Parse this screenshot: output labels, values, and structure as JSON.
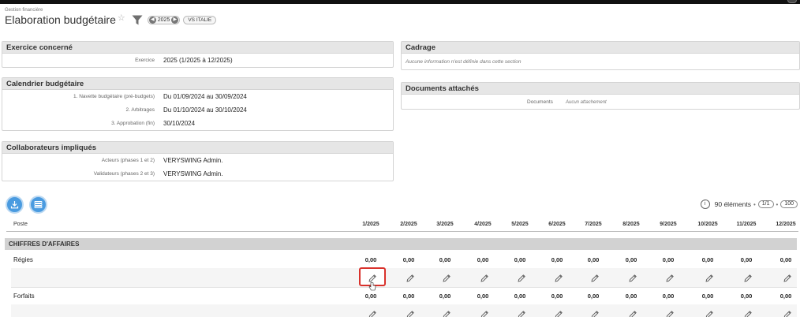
{
  "header": {
    "breadcrumb": "Gestion financière",
    "title": "Elaboration budgétaire",
    "year": "2025",
    "company": "VS ITALIE"
  },
  "panels": {
    "exercice": {
      "title": "Exercice concerné",
      "rows": [
        {
          "label": "Exercice",
          "value": "2025 (1/2025 à 12/2025)"
        }
      ]
    },
    "calendrier": {
      "title": "Calendrier budgétaire",
      "rows": [
        {
          "label": "1. Navette budgétaire (pré-budgets)",
          "value": "Du 01/09/2024 au 30/09/2024"
        },
        {
          "label": "2. Arbitrages",
          "value": "Du 01/10/2024 au 30/10/2024"
        },
        {
          "label": "3. Approbation (fin)",
          "value": "30/10/2024"
        }
      ]
    },
    "collaborateurs": {
      "title": "Collaborateurs impliqués",
      "rows": [
        {
          "label": "Acteurs (phases 1 et 2)",
          "value": "VERYSWING Admin."
        },
        {
          "label": "Validateurs (phases 2 et 3)",
          "value": "VERYSWING Admin."
        }
      ]
    },
    "cadrage": {
      "title": "Cadrage",
      "note": "Aucune information n'est définie dans cette section"
    },
    "documents": {
      "title": "Documents attachés",
      "label": "Documents",
      "value": "Aucun attachement"
    }
  },
  "list": {
    "count_value": "90",
    "count_unit": "éléments",
    "page": "1/1",
    "per_page": "100",
    "poste_header": "Poste",
    "months": [
      "1/2025",
      "2/2025",
      "3/2025",
      "4/2025",
      "5/2025",
      "6/2025",
      "7/2025",
      "8/2025",
      "9/2025",
      "10/2025",
      "11/2025",
      "12/2025"
    ],
    "section": "CHIFFRES D'AFFAIRES",
    "rows": [
      {
        "label": "Régies",
        "values": [
          "0,00",
          "0,00",
          "0,00",
          "0,00",
          "0,00",
          "0,00",
          "0,00",
          "0,00",
          "0,00",
          "0,00",
          "0,00",
          "0,00"
        ]
      },
      {
        "label": "Forfaits",
        "values": [
          "0,00",
          "0,00",
          "0,00",
          "0,00",
          "0,00",
          "0,00",
          "0,00",
          "0,00",
          "0,00",
          "0,00",
          "0,00",
          "0,00"
        ]
      }
    ]
  },
  "icons": {
    "favorite": "star-icon",
    "filter": "funnel-icon",
    "prev": "chevron-left-icon",
    "next": "chevron-right-icon",
    "export": "download-icon",
    "view": "list-settings-icon",
    "info": "info-icon",
    "edit": "pencil-icon",
    "pointer": "hand-cursor-icon"
  },
  "colors": {
    "accent": "#4a9be0",
    "highlight": "#d9322c",
    "panel_header": "#e6e6e6",
    "section_bar": "#d2d2d2"
  }
}
